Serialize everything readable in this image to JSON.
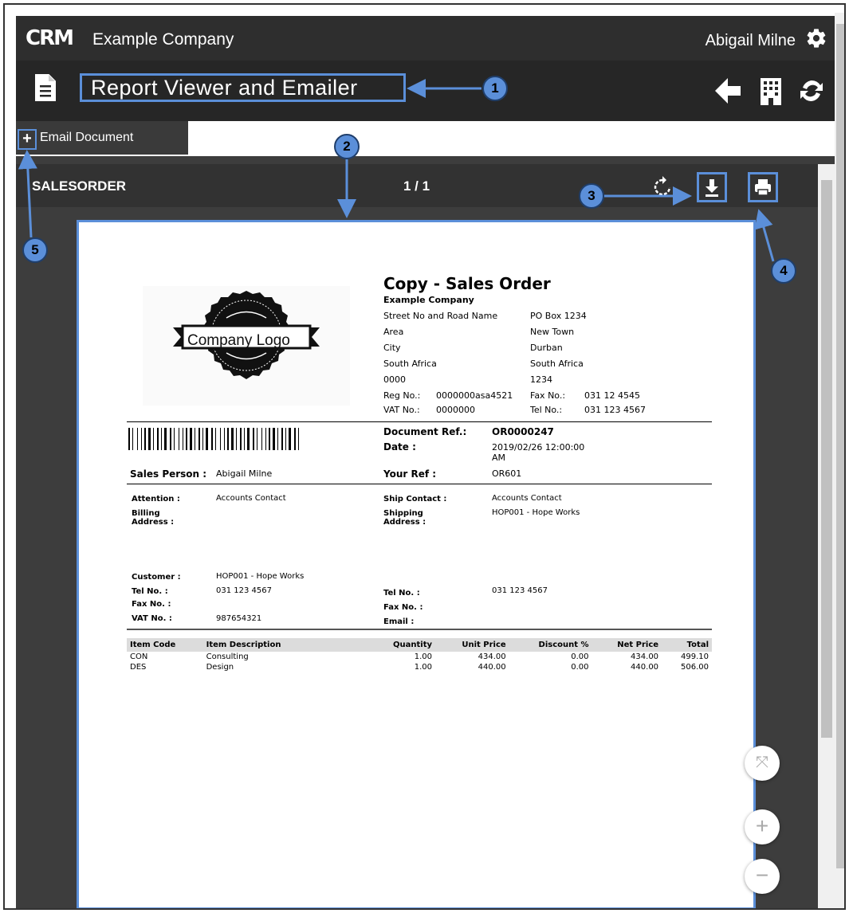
{
  "app": {
    "logo_text": "CRM",
    "company": "Example Company",
    "user": "Abigail Milne"
  },
  "titlebar": {
    "title": "Report Viewer and Emailer"
  },
  "email_tab": {
    "plus": "+",
    "label": "Email Document"
  },
  "viewer": {
    "report_name": "SALESORDER",
    "page_indicator": "1 / 1"
  },
  "document": {
    "logo_text": "Company Logo",
    "heading": "Copy - Sales Order",
    "company_name": "Example Company",
    "address_left": [
      "Street No and Road Name",
      "Area",
      "City",
      "South Africa",
      "0000"
    ],
    "address_right": [
      "PO Box 1234",
      "New Town",
      "Durban",
      "South Africa",
      "1234"
    ],
    "reg_label": "Reg No.:",
    "reg_value": "0000000asa4521",
    "fax_label": "Fax No.:",
    "fax_value": "031 12 4545",
    "vat_label": "VAT No.:",
    "vat_value": "0000000",
    "tel_label": "Tel No.:",
    "tel_value": "031 123 4567",
    "docref_label": "Document Ref.:",
    "docref_value": "OR0000247",
    "date_label": "Date :",
    "date_value": "2019/02/26 12:00:00",
    "date_value2": "AM",
    "salesperson_label": "Sales Person :",
    "salesperson_value": "Abigail Milne",
    "yourref_label": "Your Ref :",
    "yourref_value": "OR601",
    "attention_label": "Attention :",
    "attention_value": "Accounts Contact",
    "billing_label": "Billing",
    "billing_label2": "Address :",
    "shipcontact_label": "Ship Contact :",
    "shipcontact_value": "Accounts Contact",
    "shipping_label": "Shipping",
    "shipping_label2": "Address :",
    "shipping_value": "HOP001 - Hope Works",
    "customer_label": "Customer :",
    "customer_value": "HOP001 - Hope Works",
    "cust_tel_label": "Tel No. :",
    "cust_tel_value": "031 123 4567",
    "cust_fax_label": "Fax No. :",
    "cust_vat_label": "VAT No. :",
    "cust_vat_value": "987654321",
    "ship_tel_label": "Tel No. :",
    "ship_tel_value": "031 123 4567",
    "ship_fax_label": "Fax No. :",
    "ship_email_label": "Email :",
    "items_headers": [
      "Item Code",
      "Item Description",
      "Quantity",
      "Unit Price",
      "Discount %",
      "Net Price",
      "Total"
    ],
    "items": [
      [
        "CON",
        "Consulting",
        "1.00",
        "434.00",
        "0.00",
        "434.00",
        "499.10"
      ],
      [
        "DES",
        "Design",
        "1.00",
        "440.00",
        "0.00",
        "440.00",
        "506.00"
      ]
    ]
  },
  "callouts": [
    "1",
    "2",
    "3",
    "4",
    "5"
  ],
  "zoom": {
    "fit": "⤧",
    "in": "+",
    "out": "−"
  },
  "colors": {
    "accent": "#5b8fd9",
    "topbar": "#2e2e2e",
    "titlebar": "#262626",
    "viewer_bg": "#3d3d3d"
  },
  "icons": [
    "gear-icon",
    "document-icon",
    "back-arrow-icon",
    "building-icon",
    "refresh-icon",
    "rotate-icon",
    "download-icon",
    "print-icon"
  ]
}
